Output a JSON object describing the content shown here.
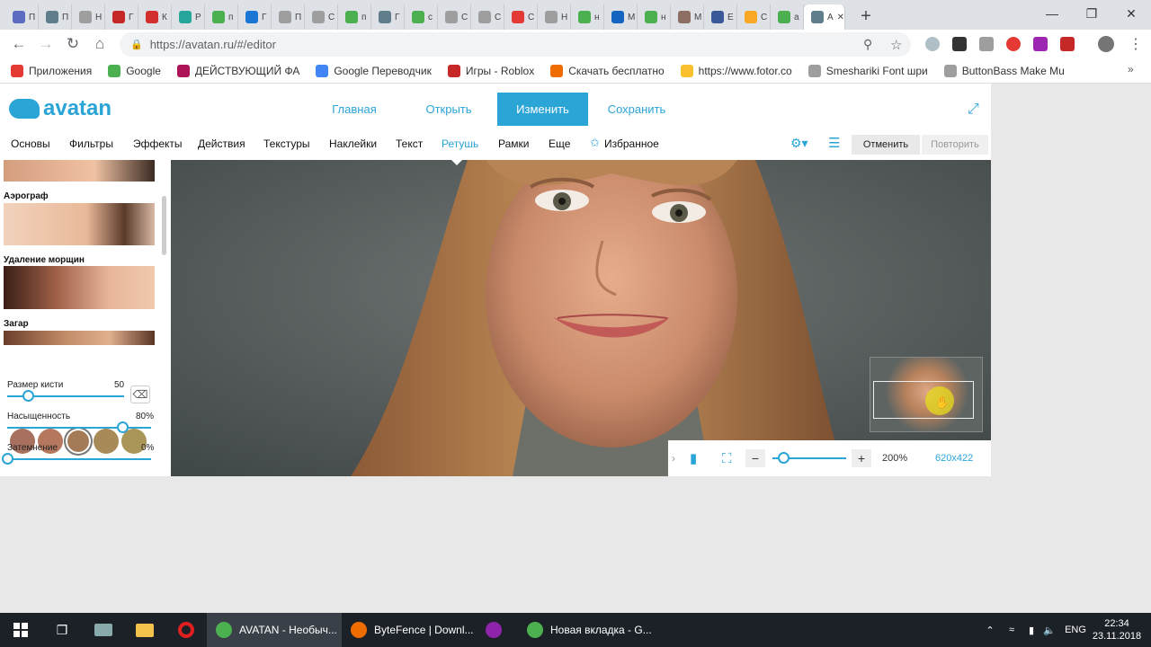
{
  "browser": {
    "url": "https://avatan.ru/#/editor",
    "tabs": [
      {
        "label": "П",
        "color": "#5c6bc0"
      },
      {
        "label": "П",
        "color": "#607d8b"
      },
      {
        "label": "Н",
        "color": "#9e9e9e"
      },
      {
        "label": "Г",
        "color": "#c62828"
      },
      {
        "label": "К",
        "color": "#d32f2f"
      },
      {
        "label": "Р",
        "color": "#26a69a"
      },
      {
        "label": "п",
        "color": "#4caf50"
      },
      {
        "label": "Г",
        "color": "#1976d2"
      },
      {
        "label": "П",
        "color": "#9e9e9e"
      },
      {
        "label": "С",
        "color": "#9e9e9e"
      },
      {
        "label": "п",
        "color": "#4caf50"
      },
      {
        "label": "Г",
        "color": "#607d8b"
      },
      {
        "label": "с",
        "color": "#4caf50"
      },
      {
        "label": "С",
        "color": "#9e9e9e"
      },
      {
        "label": "С",
        "color": "#9e9e9e"
      },
      {
        "label": "С",
        "color": "#e53935"
      },
      {
        "label": "Н",
        "color": "#9e9e9e"
      },
      {
        "label": "н",
        "color": "#4caf50"
      },
      {
        "label": "М",
        "color": "#1565c0"
      },
      {
        "label": "н",
        "color": "#4caf50"
      },
      {
        "label": "М",
        "color": "#8d6e63"
      },
      {
        "label": "Е",
        "color": "#3b5998"
      },
      {
        "label": "С",
        "color": "#f9a825"
      },
      {
        "label": "а",
        "color": "#4caf50"
      },
      {
        "label": "A",
        "color": "#607d8b"
      }
    ],
    "bookmarks": [
      {
        "label": "Приложения",
        "color": "#e53935"
      },
      {
        "label": "Google",
        "color": "#4caf50"
      },
      {
        "label": "ДЕЙСТВУЮЩИЙ ФА",
        "color": "#ad1457"
      },
      {
        "label": "Google Переводчик",
        "color": "#4285f4"
      },
      {
        "label": "Игры - Roblox",
        "color": "#c62828"
      },
      {
        "label": "Скачать бесплатно",
        "color": "#ef6c00"
      },
      {
        "label": "https://www.fotor.co",
        "color": "#fbc02d"
      },
      {
        "label": "Smeshariki Font шри",
        "color": "#9e9e9e"
      },
      {
        "label": "ButtonBass Make Mu",
        "color": "#9e9e9e"
      }
    ]
  },
  "app": {
    "logo": "avatan",
    "topnav": [
      "Главная",
      "Открыть",
      "Изменить",
      "Сохранить"
    ],
    "menu": [
      "Основы",
      "Фильтры",
      "Эффекты",
      "Действия",
      "Текстуры",
      "Наклейки",
      "Текст",
      "Ретушь",
      "Рамки",
      "Еще",
      "Избранное"
    ],
    "undo": "Отменить",
    "redo": "Повторить",
    "panel": {
      "sections": [
        "Аэрограф",
        "Удаление морщин",
        "Загар"
      ],
      "swatches": [
        "#a8705e",
        "#b5775e",
        "#a57a56",
        "#a88a58",
        "#a99658"
      ],
      "brush_size_label": "Размер кисти",
      "brush_size_value": "50",
      "brush_size": 50,
      "saturation_label": "Насыщенность",
      "saturation_value": "80%",
      "saturation": 0.8,
      "darkening_label": "Затемнение",
      "darkening_value": "0%",
      "darkening": 0
    },
    "zoom": {
      "percent": "200%",
      "dimensions": "620x422",
      "level": 0.15
    }
  },
  "taskbar": {
    "apps": [
      {
        "label": "AVATAN - Необыч...",
        "color": "#4caf50",
        "active": true
      },
      {
        "label": "ByteFence | Downl...",
        "color": "#ef6c00",
        "active": false
      },
      {
        "label": "",
        "color": "#8e24aa",
        "active": false
      },
      {
        "label": "Новая вкладка - G...",
        "color": "#4caf50",
        "active": false
      }
    ],
    "lang": "ENG",
    "time": "22:34",
    "date": "23.11.2018"
  }
}
